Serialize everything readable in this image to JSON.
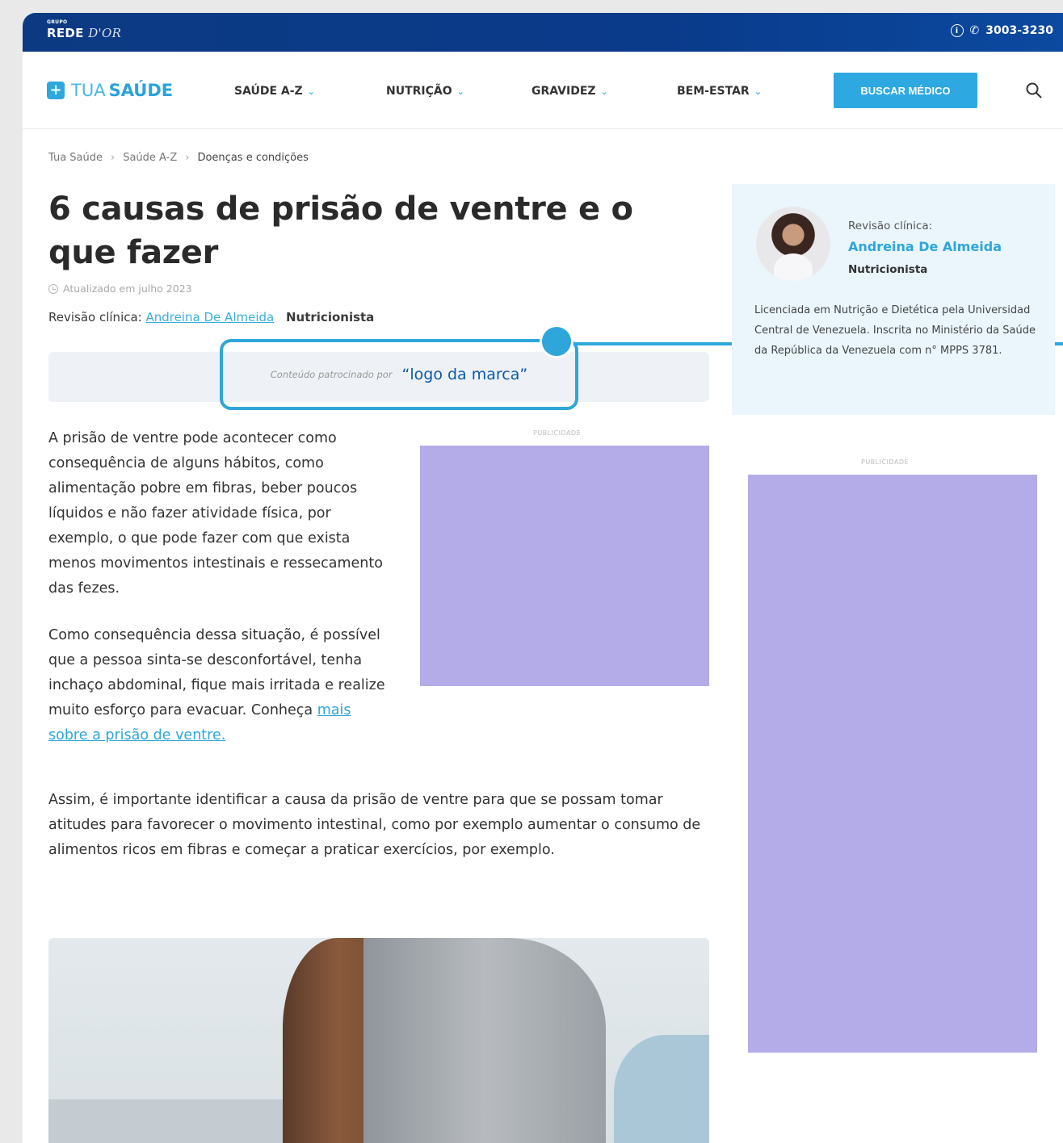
{
  "topbar": {
    "brand_small": "GRUPO",
    "brand_main": "REDE",
    "brand_script": "D'OR",
    "phone": "3003-3230"
  },
  "nav": {
    "logo_part1": "TUA",
    "logo_part2": "SAÚDE",
    "items": [
      {
        "label": "SAÚDE A-Z"
      },
      {
        "label": "NUTRIÇÃO"
      },
      {
        "label": "GRAVIDEZ"
      },
      {
        "label": "BEM-ESTAR"
      }
    ],
    "cta": "BUSCAR MÉDICO"
  },
  "breadcrumb": [
    "Tua Saúde",
    "Saúde A-Z",
    "Doenças e condições"
  ],
  "article": {
    "title": "6 causas de prisão de ventre e o que fazer",
    "updated": "Atualizado em julho 2023",
    "review_prefix": "Revisão clínica:",
    "review_name": "Andreina De Almeida",
    "review_role": "Nutricionista",
    "sponsor_label": "Conteúdo patrocinado por",
    "sponsor_brand": "“logo da marca”",
    "p1": "A prisão de ventre pode acontecer como consequência de alguns hábitos, como alimentação pobre em fibras, beber poucos líquidos e não fazer atividade física, por exemplo, o que pode fazer com que exista menos movimentos intestinais e ressecamento das fezes.",
    "p2_text": "Como consequência dessa situação, é possível que a pessoa sinta-se desconfortável, tenha inchaço abdominal, fique mais irritada e realize muito esforço para evacuar. Conheça ",
    "p2_link": "mais sobre a prisão de ventre.",
    "p3": "Assim, é importante identificar a causa da prisão de ventre para que se possam tomar atitudes para favorecer o movimento intestinal, como por exemplo aumentar o consumo de alimentos ricos em fibras e começar a praticar exercícios, por exemplo."
  },
  "ads": {
    "label": "PUBLICIDADE",
    "color": "#b3ace8"
  },
  "reviewer": {
    "label": "Revisão clínica:",
    "name": "Andreina De Almeida",
    "role": "Nutricionista",
    "bio": "Licenciada em Nutrição e Dietética pela Universidad Central de Venezuela. Inscrita no Ministério da Saúde da República da Venezuela com n° MPPS 3781."
  },
  "colors": {
    "brand_blue": "#0c3a82",
    "accent": "#2ea6da"
  }
}
